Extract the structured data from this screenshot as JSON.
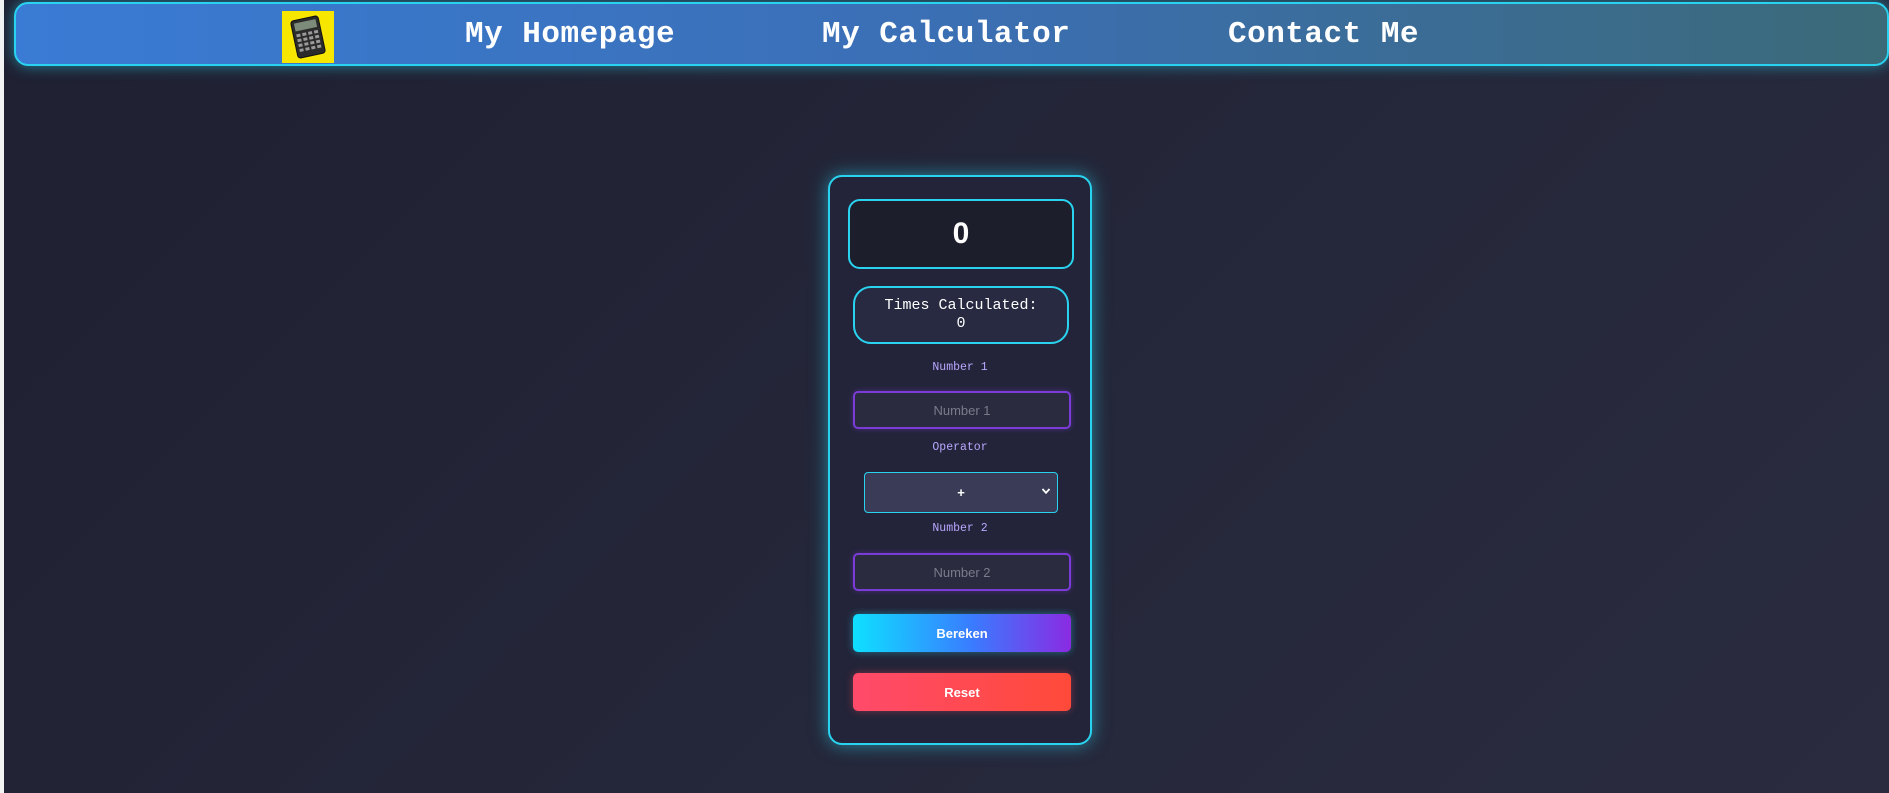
{
  "nav": {
    "logo_icon": "calculator-icon",
    "links": [
      {
        "label": "My Homepage"
      },
      {
        "label": "My Calculator"
      },
      {
        "label": "Contact Me"
      }
    ]
  },
  "calculator": {
    "display_value": "0",
    "counter": {
      "label": "Times Calculated:",
      "value": "0"
    },
    "number1": {
      "label": "Number 1",
      "placeholder": "Number 1",
      "value": ""
    },
    "operator": {
      "label": "Operator",
      "selected": "+"
    },
    "number2": {
      "label": "Number 2",
      "placeholder": "Number 2",
      "value": ""
    },
    "calculate_label": "Bereken",
    "reset_label": "Reset"
  },
  "colors": {
    "accent_cyan": "#29d3f0",
    "accent_purple": "#7b3bd6",
    "reset_red": "#ff4a5a",
    "background": "#23253a"
  }
}
